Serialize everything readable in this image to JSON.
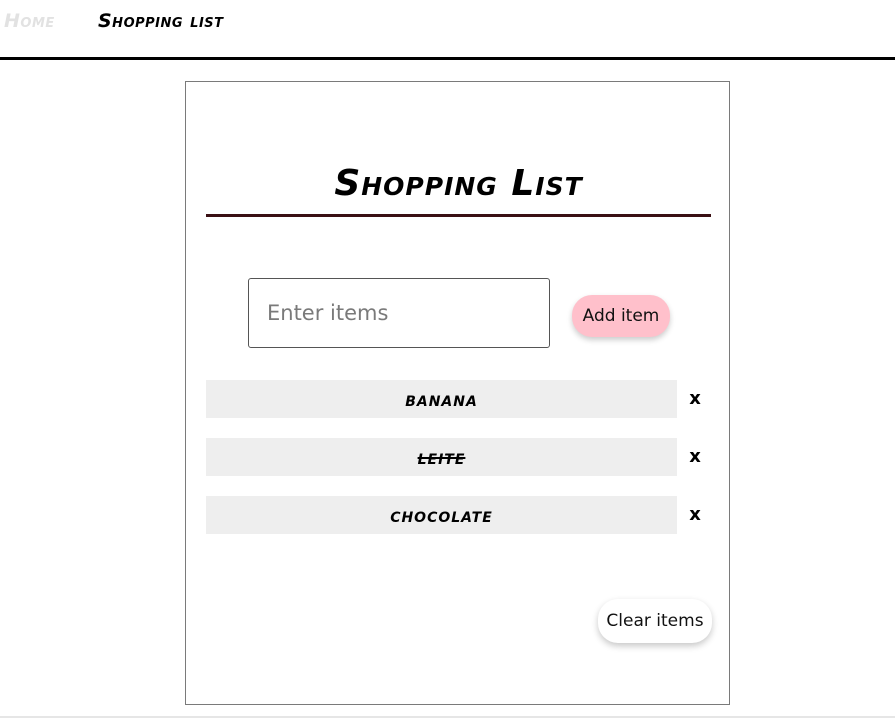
{
  "nav": {
    "home_label": "Home",
    "shopping_list_label": "Shopping list"
  },
  "card": {
    "title": "Shopping List",
    "input": {
      "placeholder": "Enter items",
      "value": ""
    },
    "add_button_label": "Add item",
    "items": [
      {
        "name": "banana",
        "completed": false,
        "remove_label": "x"
      },
      {
        "name": "leite",
        "completed": true,
        "remove_label": "x"
      },
      {
        "name": "chocolate",
        "completed": false,
        "remove_label": "x"
      }
    ],
    "clear_button_label": "Clear items"
  },
  "colors": {
    "add_button_bg": "#ffc0cb",
    "item_bg": "#eeeeee",
    "title_underline": "#3a1014",
    "nav_home_text": "#e2e2e2"
  }
}
